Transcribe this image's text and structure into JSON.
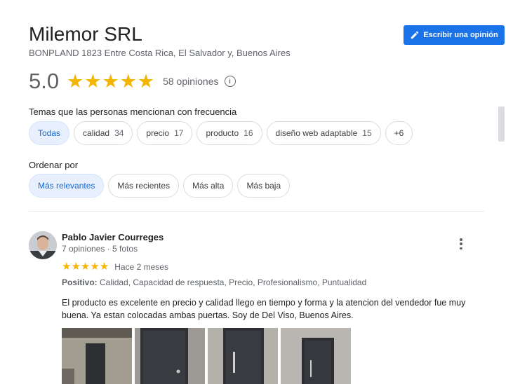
{
  "business": {
    "name": "Milemor SRL",
    "address": "BONPLAND 1823 Entre Costa Rica, El Salvador y, Buenos Aires",
    "write_review_label": "Escribir una opinión",
    "rating": "5.0",
    "rating_value": 5,
    "rating_max": 5,
    "reviews_count": "58 opiniones"
  },
  "topics": {
    "heading": "Temas que las personas mencionan con frecuencia",
    "chips": [
      {
        "label": "Todas",
        "count": ""
      },
      {
        "label": "calidad",
        "count": "34"
      },
      {
        "label": "precio",
        "count": "17"
      },
      {
        "label": "producto",
        "count": "16"
      },
      {
        "label": "diseño web adaptable",
        "count": "15"
      },
      {
        "label": "+6",
        "count": ""
      }
    ]
  },
  "sort": {
    "heading": "Ordenar por",
    "options": [
      "Más relevantes",
      "Más recientes",
      "Más alta",
      "Más baja"
    ],
    "selected": "Más relevantes"
  },
  "review": {
    "author": "Pablo Javier Courreges",
    "meta": "7 opiniones · 5 fotos",
    "stars": 5,
    "date": "Hace 2 meses",
    "positive_label": "Positivo:",
    "positive_text": "Calidad, Capacidad de respuesta, Precio, Profesionalismo, Puntualidad",
    "text": "El producto es excelente en precio y calidad llego en tiempo y forma y la atencion del vendedor fue muy buena. Ya estan colocadas ambas puertas. Soy de Del Viso, Buenos Aires."
  },
  "icons": {
    "write": "pencil-icon",
    "info": "info-icon",
    "more": "more-vert-icon",
    "star": "star-icon"
  },
  "colors": {
    "accent": "#1a73e8",
    "star": "#f4b400",
    "chip_active_bg": "#e8f0fe",
    "chip_active_text": "#1967d2"
  }
}
